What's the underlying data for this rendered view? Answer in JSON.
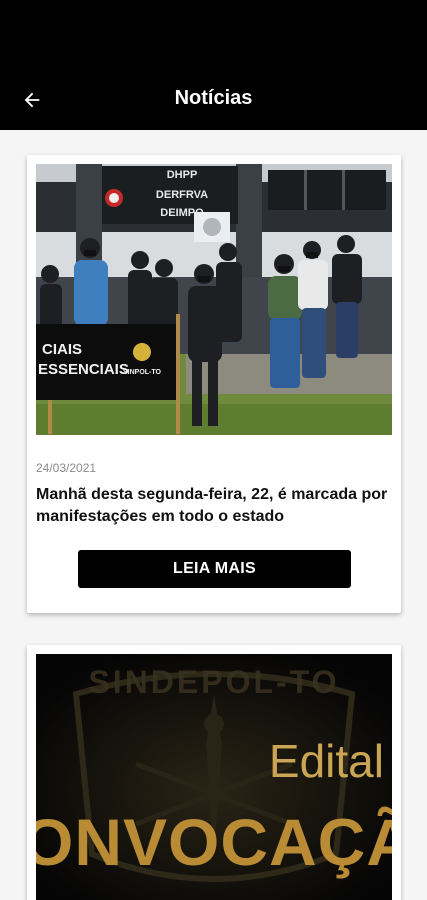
{
  "app_bar": {
    "title": "Notícias",
    "back_icon": "arrow-left-icon"
  },
  "news": [
    {
      "photo_signs": [
        "DHPP",
        "DERFRVA",
        "DEIMPO"
      ],
      "photo_banner": [
        "CIAIS",
        "ESSENCIAIS",
        "SINPOL-TO"
      ],
      "date": "24/03/2021",
      "headline": "Manhã desta segunda-feira, 22, é marcada por manifestações em todo o estado",
      "button_label": "LEIA MAIS"
    },
    {
      "banner_org": "SINDEPOL-TO",
      "banner_word_1": "Edital",
      "banner_word_2": "ONVOCAÇÃ"
    }
  ],
  "colors": {
    "app_bar_bg": "#000000",
    "button_bg": "#000000",
    "gold": "#c9a554"
  }
}
